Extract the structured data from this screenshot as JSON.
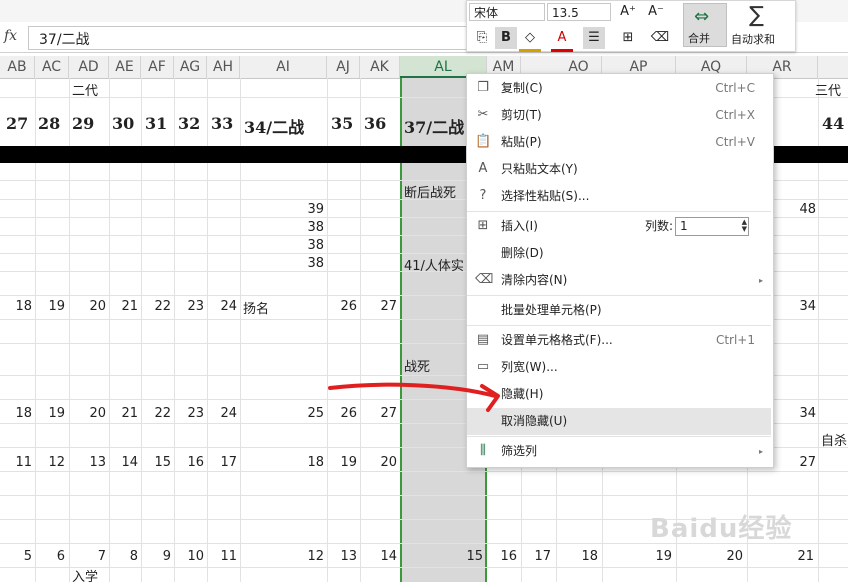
{
  "formula": {
    "fx_label": "fx",
    "value": "37/二战"
  },
  "mini_toolbar": {
    "font_name": "宋体",
    "font_size": "13.5",
    "bold": "B",
    "font_color_letter": "A",
    "merge_label": "合并",
    "autosum_label": "自动求和",
    "autosum_symbol": "∑",
    "grow_font": "A⁺",
    "shrink_font": "A⁻"
  },
  "columns": [
    {
      "id": "AB"
    },
    {
      "id": "AC"
    },
    {
      "id": "AD"
    },
    {
      "id": "AE"
    },
    {
      "id": "AF"
    },
    {
      "id": "AG"
    },
    {
      "id": "AH"
    },
    {
      "id": "AI"
    },
    {
      "id": "AJ"
    },
    {
      "id": "AK"
    },
    {
      "id": "AL"
    },
    {
      "id": "AM"
    },
    {
      "id": "AO"
    },
    {
      "id": "AP"
    },
    {
      "id": "AQ"
    },
    {
      "id": "AR"
    }
  ],
  "cells": {
    "gen2": "二代",
    "gen3": "三代",
    "h27": "27",
    "h28": "28",
    "h29": "29",
    "h30": "30",
    "h31": "31",
    "h32": "32",
    "h33": "33",
    "h34": "34/二战",
    "h35": "35",
    "h36": "36",
    "h37": "37/二战",
    "h44": "44",
    "t1": "断后战死",
    "v39": "39",
    "v38a": "38",
    "v38b": "38",
    "v38c": "38",
    "v48": "48",
    "t2": "41/人体实",
    "r1": [
      "18",
      "19",
      "20",
      "21",
      "22",
      "23",
      "24"
    ],
    "r1_name": "扬名",
    "r1_26": "26",
    "r1_27": "27",
    "r1_34": "34",
    "t3": "战死",
    "r2": [
      "18",
      "19",
      "20",
      "21",
      "22",
      "23",
      "24"
    ],
    "r2_25": "25",
    "r2_26": "26",
    "r2_27": "27",
    "r2_34": "34",
    "t4": "自杀",
    "r3": [
      "11",
      "12",
      "13",
      "14",
      "15",
      "16",
      "17"
    ],
    "r3_18": "18",
    "r3_19": "19",
    "r3_20": "20",
    "r3_27": "27",
    "r4": [
      "5",
      "6",
      "7",
      "8",
      "9",
      "10",
      "11"
    ],
    "r4_12": "12",
    "r4_13": "13",
    "r4_14": "14",
    "r4_15": "15",
    "r4_16": "16",
    "r4_17": "17",
    "r4_18": "18",
    "r4_19": "19",
    "r4_20": "20",
    "r4_21": "21",
    "t5": "入学"
  },
  "context_menu": {
    "items": [
      {
        "label": "复制(C)",
        "shortcut": "Ctrl+C",
        "icon": "copy-icon"
      },
      {
        "label": "剪切(T)",
        "shortcut": "Ctrl+X",
        "icon": "cut-icon"
      },
      {
        "label": "粘贴(P)",
        "shortcut": "Ctrl+V",
        "icon": "paste-icon"
      },
      {
        "label": "只粘贴文本(Y)",
        "shortcut": "",
        "icon": "paste-text-icon"
      },
      {
        "label": "选择性粘贴(S)...",
        "shortcut": "",
        "icon": "paste-special-icon"
      },
      {
        "label": "插入(I)",
        "shortcut": "",
        "icon": "insert-icon"
      },
      {
        "label": "删除(D)",
        "shortcut": "",
        "icon": ""
      },
      {
        "label": "清除内容(N)",
        "shortcut": "",
        "icon": "clear-icon"
      },
      {
        "label": "批量处理单元格(P)",
        "shortcut": "",
        "icon": ""
      },
      {
        "label": "设置单元格格式(F)...",
        "shortcut": "Ctrl+1",
        "icon": "format-cells-icon"
      },
      {
        "label": "列宽(W)...",
        "shortcut": "",
        "icon": "column-width-icon"
      },
      {
        "label": "隐藏(H)",
        "shortcut": "",
        "icon": ""
      },
      {
        "label": "取消隐藏(U)",
        "shortcut": "",
        "icon": ""
      },
      {
        "label": "筛选列",
        "shortcut": "",
        "icon": "filter-icon"
      }
    ],
    "insert_count_label": "列数:",
    "insert_count_value": "1"
  },
  "watermark": "Baidu经验",
  "colors": {
    "selection_border": "#3a9a3a",
    "arrow": "#e02020"
  }
}
